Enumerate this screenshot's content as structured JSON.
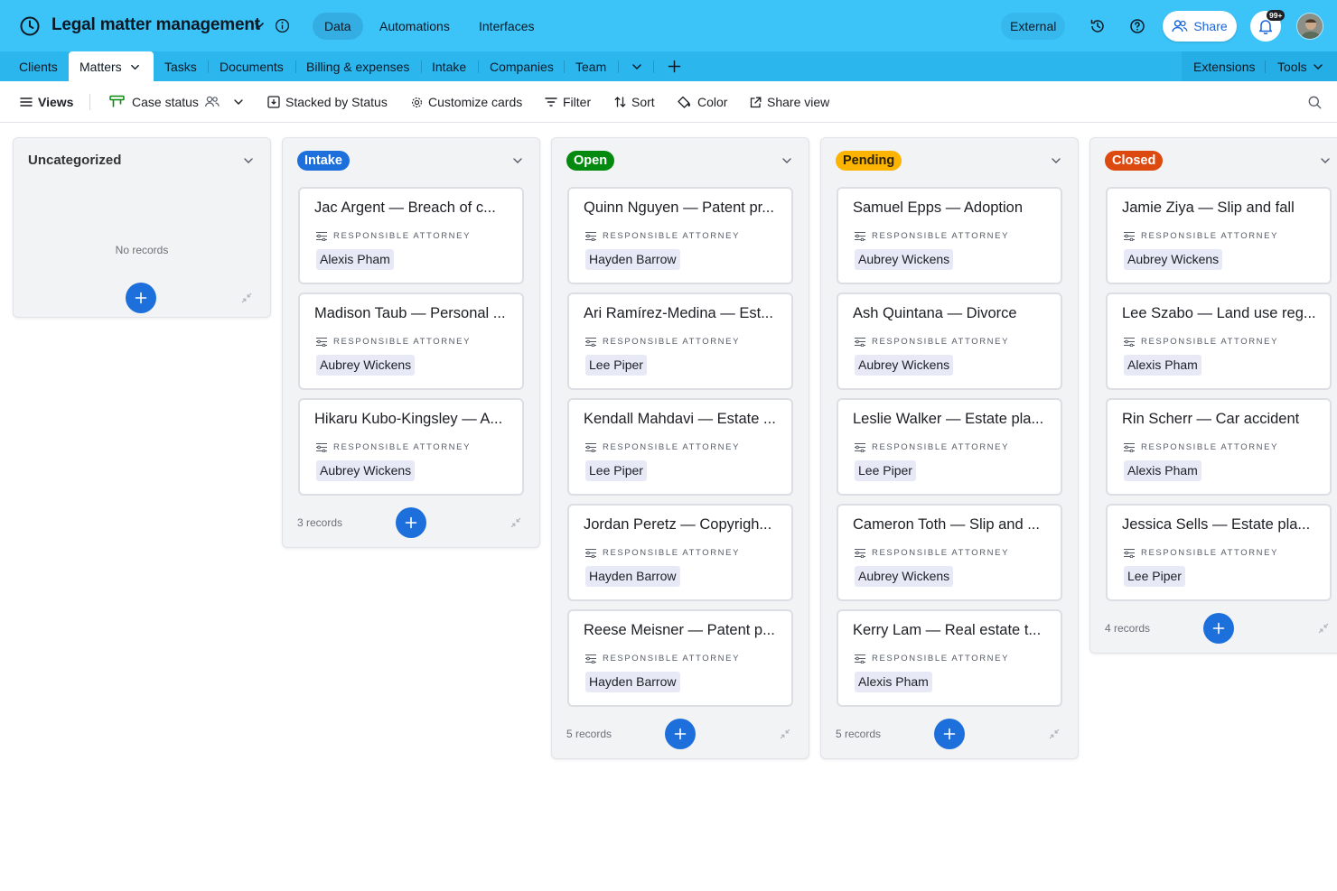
{
  "app": {
    "title": "Legal matter management",
    "nav_tabs": [
      {
        "label": "Data",
        "active": true
      },
      {
        "label": "Automations",
        "active": false
      },
      {
        "label": "Interfaces",
        "active": false
      }
    ],
    "external_label": "External",
    "share_label": "Share",
    "notification_badge": "99+",
    "accent_color": "#3cc3f8"
  },
  "tables": {
    "tabs": [
      "Clients",
      "Matters",
      "Tasks",
      "Documents",
      "Billing & expenses",
      "Intake",
      "Companies",
      "Team"
    ],
    "active": "Matters",
    "extensions_label": "Extensions",
    "tools_label": "Tools"
  },
  "viewbar": {
    "views_label": "Views",
    "view_name": "Case status",
    "stacked_label": "Stacked by Status",
    "customize_label": "Customize cards",
    "filter_label": "Filter",
    "sort_label": "Sort",
    "color_label": "Color",
    "share_view_label": "Share view"
  },
  "board": {
    "field_label": "RESPONSIBLE ATTORNEY",
    "columns": [
      {
        "title": "Uncategorized",
        "pill": false,
        "empty_text": "No records",
        "count_text": "",
        "cards": []
      },
      {
        "title": "Intake",
        "pill": true,
        "color": "#1d6fdc",
        "text_color": "#ffffff",
        "count_text": "3 records",
        "cards": [
          {
            "title": "Jac Argent — Breach of c...",
            "attorney": "Alexis Pham"
          },
          {
            "title": "Madison Taub — Personal ...",
            "attorney": "Aubrey Wickens"
          },
          {
            "title": "Hikaru Kubo-Kingsley — A...",
            "attorney": "Aubrey Wickens"
          }
        ]
      },
      {
        "title": "Open",
        "pill": true,
        "color": "#048a0e",
        "text_color": "#ffffff",
        "count_text": "5 records",
        "cards": [
          {
            "title": "Quinn Nguyen — Patent pr...",
            "attorney": "Hayden Barrow"
          },
          {
            "title": "Ari Ramírez-Medina — Est...",
            "attorney": "Lee Piper"
          },
          {
            "title": "Kendall Mahdavi — Estate ...",
            "attorney": "Lee Piper"
          },
          {
            "title": "Jordan Peretz — Copyrigh...",
            "attorney": "Hayden Barrow"
          },
          {
            "title": "Reese Meisner — Patent p...",
            "attorney": "Hayden Barrow"
          }
        ]
      },
      {
        "title": "Pending",
        "pill": true,
        "color": "#fcb400",
        "text_color": "#2b2100",
        "count_text": "5 records",
        "cards": [
          {
            "title": "Samuel Epps — Adoption",
            "attorney": "Aubrey Wickens"
          },
          {
            "title": "Ash Quintana — Divorce",
            "attorney": "Aubrey Wickens"
          },
          {
            "title": "Leslie Walker — Estate pla...",
            "attorney": "Lee Piper"
          },
          {
            "title": "Cameron Toth — Slip and ...",
            "attorney": "Aubrey Wickens"
          },
          {
            "title": "Kerry Lam — Real estate t...",
            "attorney": "Alexis Pham"
          }
        ]
      },
      {
        "title": "Closed",
        "pill": true,
        "color": "#dc4a10",
        "text_color": "#ffffff",
        "count_text": "4 records",
        "cards": [
          {
            "title": "Jamie Ziya — Slip and fall",
            "attorney": "Aubrey Wickens"
          },
          {
            "title": "Lee Szabo — Land use reg...",
            "attorney": "Alexis Pham"
          },
          {
            "title": "Rin Scherr — Car accident",
            "attorney": "Alexis Pham"
          },
          {
            "title": "Jessica Sells — Estate pla...",
            "attorney": "Lee Piper"
          }
        ]
      }
    ]
  }
}
